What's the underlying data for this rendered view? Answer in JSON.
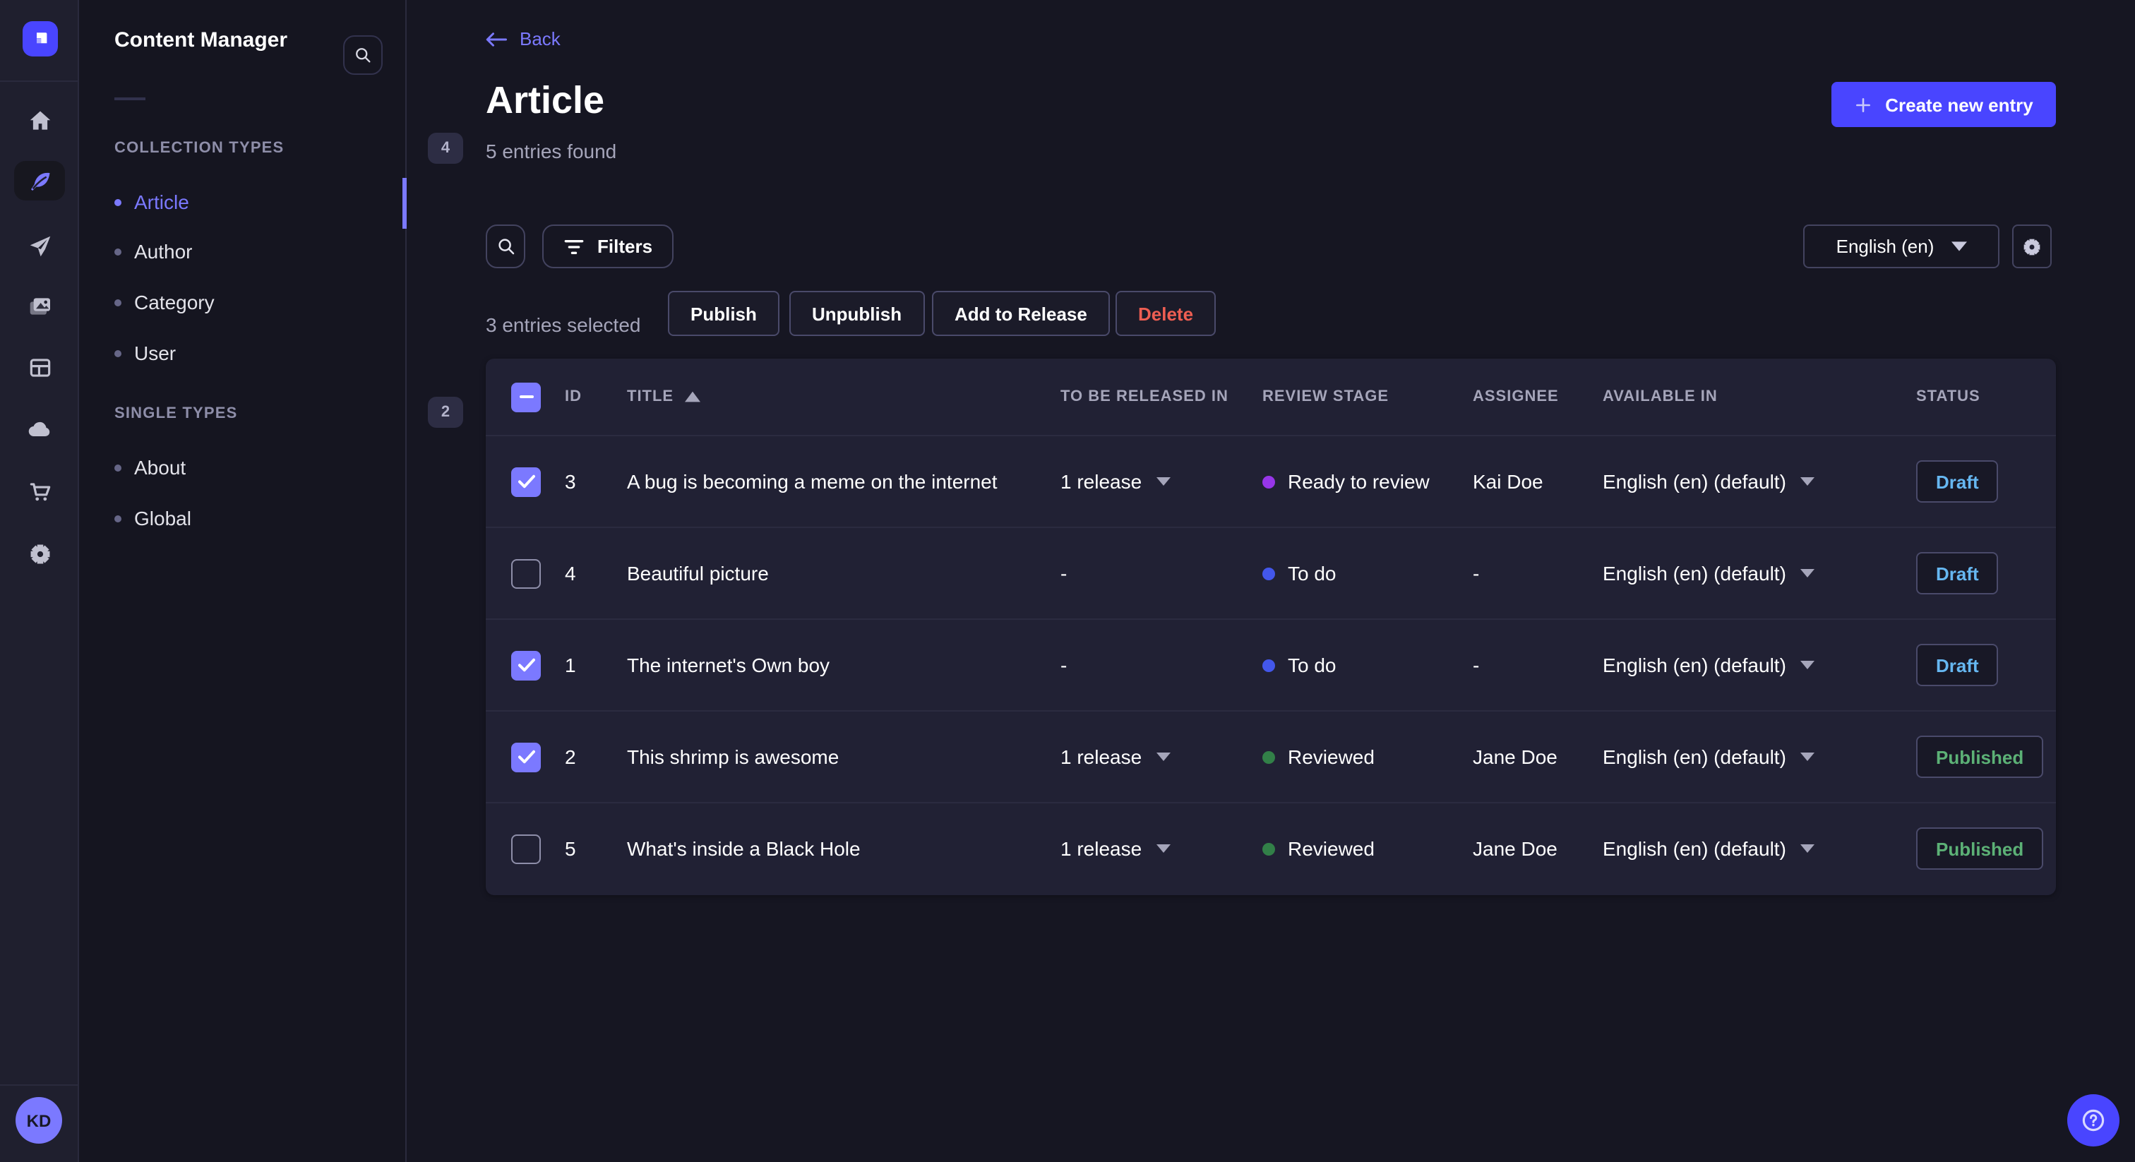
{
  "brand": {
    "primary": "#4945ff",
    "secondary": "#7b79ff"
  },
  "sidebar": {
    "icons": [
      {
        "name": "home",
        "active": false
      },
      {
        "name": "content-manager",
        "active": true
      },
      {
        "name": "releases",
        "active": false
      },
      {
        "name": "media-library",
        "active": false
      },
      {
        "name": "content-type-builder",
        "active": false
      },
      {
        "name": "deploy",
        "active": false
      },
      {
        "name": "marketplace",
        "active": false
      },
      {
        "name": "settings",
        "active": false
      }
    ],
    "avatar_initials": "KD"
  },
  "subnav": {
    "title": "Content Manager",
    "sections": [
      {
        "label": "COLLECTION TYPES",
        "badge": "4",
        "items": [
          {
            "label": "Article",
            "active": true
          },
          {
            "label": "Author",
            "active": false
          },
          {
            "label": "Category",
            "active": false
          },
          {
            "label": "User",
            "active": false
          }
        ]
      },
      {
        "label": "SINGLE TYPES",
        "badge": "2",
        "items": [
          {
            "label": "About",
            "active": false
          },
          {
            "label": "Global",
            "active": false
          }
        ]
      }
    ]
  },
  "header": {
    "back_label": "Back",
    "title": "Article",
    "subtitle": "5 entries found",
    "create_label": "Create new entry"
  },
  "toolbar": {
    "filters_label": "Filters",
    "locale_value": "English (en)",
    "selected_text": "3 entries selected",
    "publish_label": "Publish",
    "unpublish_label": "Unpublish",
    "add_release_label": "Add to Release",
    "delete_label": "Delete"
  },
  "table": {
    "columns": {
      "id": "ID",
      "title": "TITLE",
      "released": "TO BE RELEASED IN",
      "stage": "REVIEW STAGE",
      "assignee": "ASSIGNEE",
      "available": "AVAILABLE IN",
      "status": "STATUS"
    },
    "rows": [
      {
        "checked": true,
        "id": "3",
        "title": "A bug is becoming a meme on the internet",
        "release": "1 release",
        "has_release": true,
        "stage": "Ready to review",
        "stage_color": "#9736e8",
        "assignee": "Kai Doe",
        "locale": "English (en) (default)",
        "status": "Draft",
        "status_color": "#66b7f1"
      },
      {
        "checked": false,
        "id": "4",
        "title": "Beautiful picture",
        "release": "-",
        "has_release": false,
        "stage": "To do",
        "stage_color": "#4357eb",
        "assignee": "-",
        "locale": "English (en) (default)",
        "status": "Draft",
        "status_color": "#66b7f1"
      },
      {
        "checked": true,
        "id": "1",
        "title": "The internet's Own boy",
        "release": "-",
        "has_release": false,
        "stage": "To do",
        "stage_color": "#4357eb",
        "assignee": "-",
        "locale": "English (en) (default)",
        "status": "Draft",
        "status_color": "#66b7f1"
      },
      {
        "checked": true,
        "id": "2",
        "title": "This shrimp is awesome",
        "release": "1 release",
        "has_release": true,
        "stage": "Reviewed",
        "stage_color": "#328048",
        "assignee": "Jane Doe",
        "locale": "English (en) (default)",
        "status": "Published",
        "status_color": "#5cb176"
      },
      {
        "checked": false,
        "id": "5",
        "title": "What's inside a Black Hole",
        "release": "1 release",
        "has_release": true,
        "stage": "Reviewed",
        "stage_color": "#328048",
        "assignee": "Jane Doe",
        "locale": "English (en) (default)",
        "status": "Published",
        "status_color": "#5cb176"
      }
    ]
  }
}
